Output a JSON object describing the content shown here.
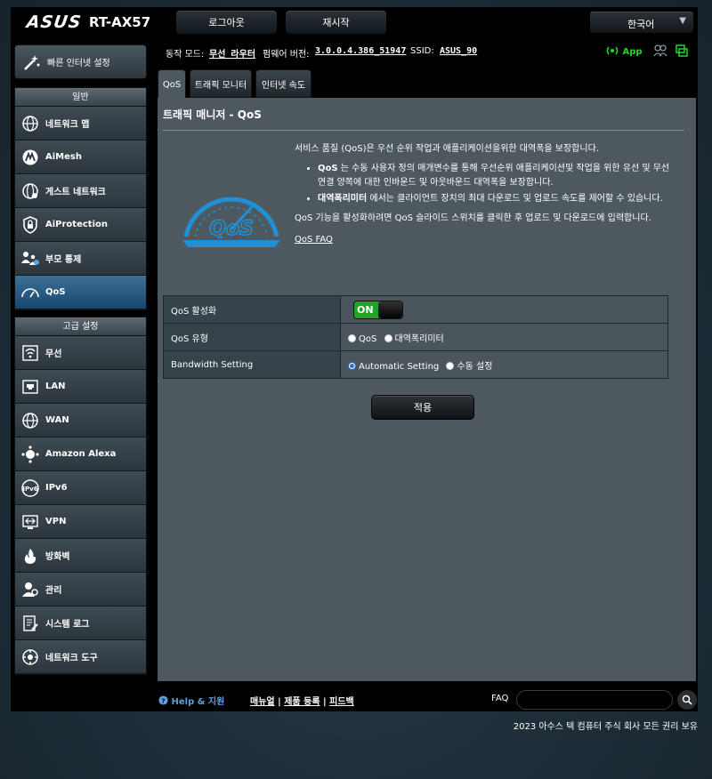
{
  "header": {
    "logo": "ASUS",
    "model": "RT-AX57",
    "logout": "로그아웃",
    "reboot": "재시작",
    "language": "한국어"
  },
  "status": {
    "mode_label": "동작 모드:",
    "mode_value": "무선 라우터",
    "firmware_label": "펌웨어 버전:",
    "firmware_value": "3.0.0.4.386_51947",
    "ssid_label": "SSID:",
    "ssid_value": "ASUS_90",
    "app_label": "App"
  },
  "sidebar": {
    "quick_setup": "빠른 인터넷 설정",
    "general_header": "일반",
    "general_items": [
      {
        "label": "네트워크 맵",
        "icon": "network-map-icon"
      },
      {
        "label": "AiMesh",
        "icon": "aimesh-icon"
      },
      {
        "label": "게스트 네트워크",
        "icon": "guest-network-icon"
      },
      {
        "label": "AiProtection",
        "icon": "aiprotection-icon"
      },
      {
        "label": "부모 통제",
        "icon": "parental-control-icon"
      },
      {
        "label": "QoS",
        "icon": "qos-icon"
      }
    ],
    "advanced_header": "고급 설정",
    "advanced_items": [
      {
        "label": "무선",
        "icon": "wireless-icon"
      },
      {
        "label": "LAN",
        "icon": "lan-icon"
      },
      {
        "label": "WAN",
        "icon": "wan-icon"
      },
      {
        "label": "Amazon Alexa",
        "icon": "alexa-icon"
      },
      {
        "label": "IPv6",
        "icon": "ipv6-icon"
      },
      {
        "label": "VPN",
        "icon": "vpn-icon"
      },
      {
        "label": "방화벽",
        "icon": "firewall-icon"
      },
      {
        "label": "관리",
        "icon": "admin-icon"
      },
      {
        "label": "시스템 로그",
        "icon": "system-log-icon"
      },
      {
        "label": "네트워크 도구",
        "icon": "network-tools-icon"
      }
    ]
  },
  "tabs": [
    "QoS",
    "트래픽 모니터",
    "인터넷 속도"
  ],
  "main": {
    "title": "트래픽 매니저 - QoS",
    "intro": "서비스 품질 (QoS)은 우선 순위 작업과 애플리케이션을위한 대역폭을 보장합니다.",
    "bullet1_bold": "QoS",
    "bullet1_text": " 는 수동 사용자 정의 매개변수를 통해 우선순위 애플리케이션및 작업을 위한 유선 및 무선 연결 양쪽에 대한 인바운드 및 아웃바운드 대역폭을 보장합니다.",
    "bullet2_bold": "대역폭리미터",
    "bullet2_text": " 에서는 클라이언트 장치의 최대 다운로드 및 업로드 속도를 제어할 수 있습니다.",
    "instruction": "QoS 기능을 활성화하려면 QoS 슬라이드 스위치를 클릭한 후 업로드 및 다운로드에 입력합니다.",
    "faq_link": "QoS FAQ",
    "logo_text": "QoS",
    "settings": {
      "enable_label": "QoS 활성화",
      "enable_value": "ON",
      "type_label": "QoS 유형",
      "type_opt1": "QoS",
      "type_opt2": "대역폭리미터",
      "bandwidth_label": "Bandwidth Setting",
      "bw_opt1": "Automatic Setting",
      "bw_opt2": "수동 설정"
    },
    "apply": "적용"
  },
  "footer": {
    "help": "Help & 지원",
    "manual": "매뉴얼",
    "registration": "제품 등록",
    "feedback": "피드백",
    "sep": " | ",
    "faq": "FAQ",
    "copyright": "2023 아수스 텍 컴퓨터 주식 회사 모든 권리 보유"
  },
  "colors": {
    "accent_blue": "#1f8fd6",
    "toggle_on": "#1fa32a",
    "app_green": "#25d62e",
    "active_menu": "#18476e"
  }
}
